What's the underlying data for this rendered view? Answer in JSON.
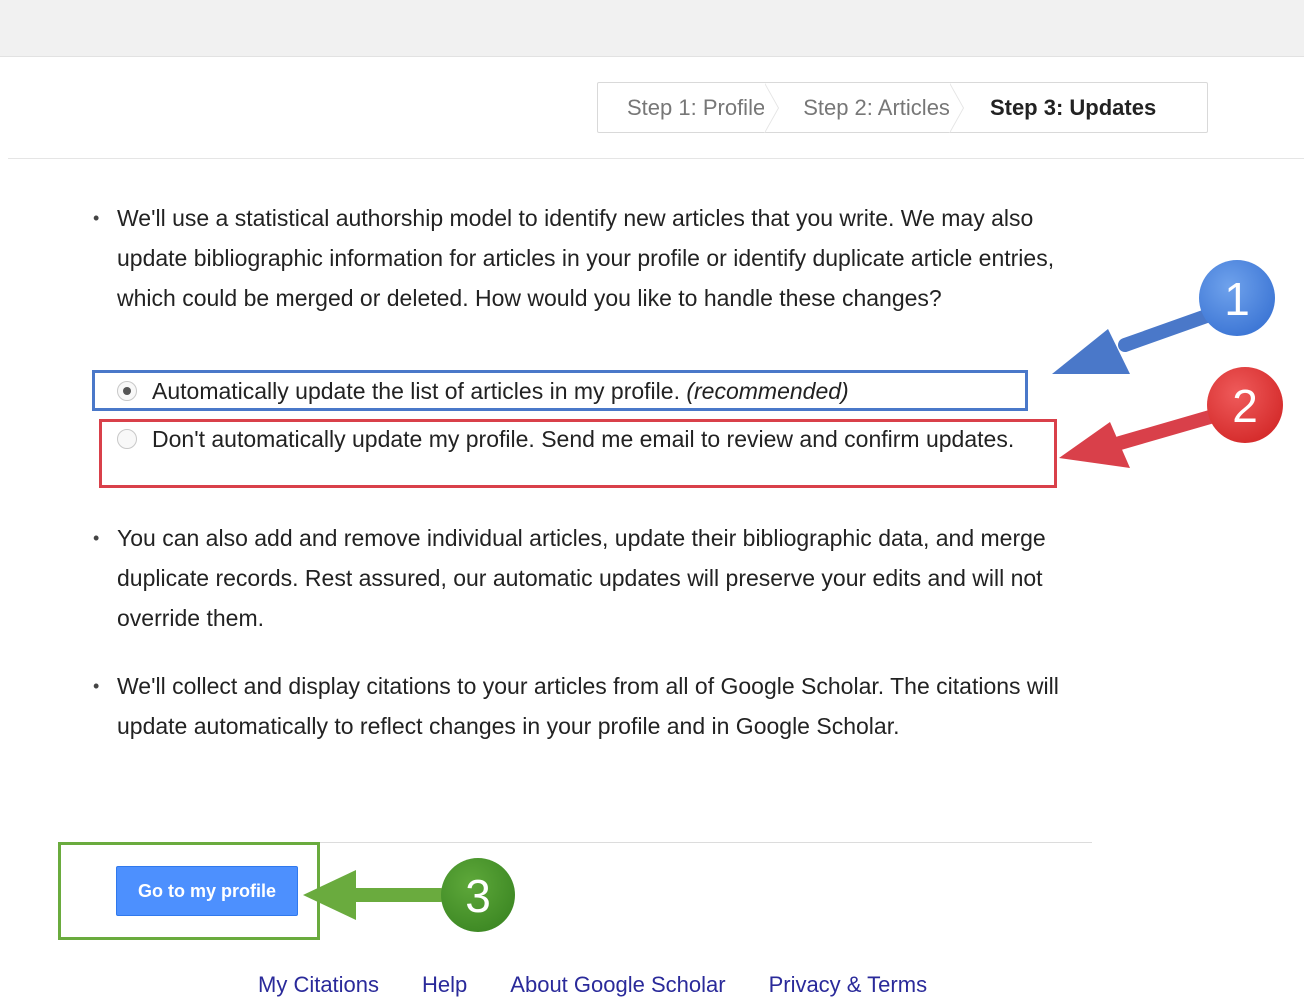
{
  "steps": [
    {
      "label": "Step 1: Profile",
      "active": false
    },
    {
      "label": "Step 2: Articles",
      "active": false
    },
    {
      "label": "Step 3: Updates",
      "active": true
    }
  ],
  "content": {
    "intro": "We'll use a statistical authorship model to identify new articles that you write. We may also update bibliographic information for articles in your profile or identify duplicate article entries, which could be merged or deleted. How would you like to handle these changes?",
    "option_auto": "Automatically update the list of articles in my profile.",
    "option_auto_note": "(recommended)",
    "option_manual": "Don't automatically update my profile. Send me email to review and confirm updates.",
    "selected_option": "auto",
    "edits_note": "You can also add and remove individual articles, update their bibliographic data, and merge duplicate records. Rest assured, our automatic updates will preserve your edits and will not override them.",
    "citations_note": "We'll collect and display citations to your articles from all of Google Scholar. The citations will update automatically to reflect changes in your profile and in Google Scholar."
  },
  "button": {
    "label": "Go to my profile"
  },
  "footer": {
    "links": [
      "My Citations",
      "Help",
      "About Google Scholar",
      "Privacy & Terms"
    ]
  },
  "annotations": {
    "marker_1": "1",
    "marker_2": "2",
    "marker_3": "3",
    "colors": {
      "blue": "#4a78c9",
      "red": "#d9404a",
      "green": "#6aab3e"
    }
  }
}
